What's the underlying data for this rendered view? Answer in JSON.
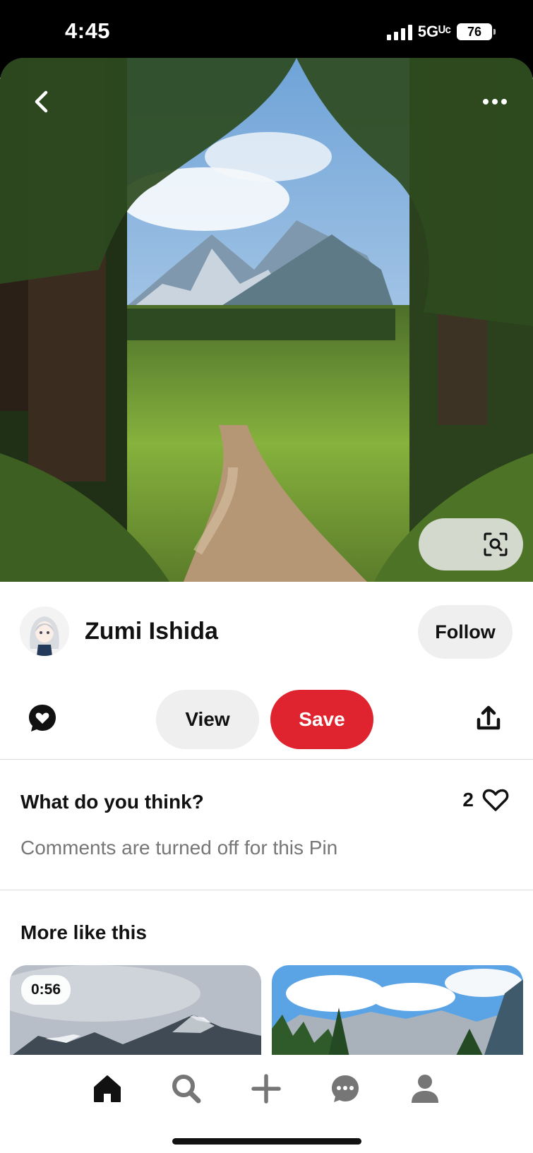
{
  "status_bar": {
    "time": "4:45",
    "network": "5Gᵁᶜ",
    "battery": "76"
  },
  "pin": {
    "creator_name": "Zumi Ishida",
    "follow_label": "Follow",
    "view_label": "View",
    "save_label": "Save"
  },
  "comments": {
    "title": "What do you think?",
    "like_count": "2",
    "note": "Comments are turned off for this Pin"
  },
  "more_like_this": {
    "title": "More like this",
    "cards": [
      {
        "duration": "0:56"
      },
      {
        "duration": ""
      }
    ]
  },
  "colors": {
    "save_button": "#e0242f",
    "secondary_button": "#efefef",
    "muted_text": "#767676"
  },
  "icons": {
    "back": "chevron-left-icon",
    "more": "more-horizontal-icon",
    "lens": "visual-search-icon",
    "react": "heart-bubble-icon",
    "share": "share-icon",
    "like": "heart-outline-icon",
    "nav": [
      "home-icon",
      "search-icon",
      "plus-icon",
      "chat-icon",
      "profile-icon"
    ]
  }
}
